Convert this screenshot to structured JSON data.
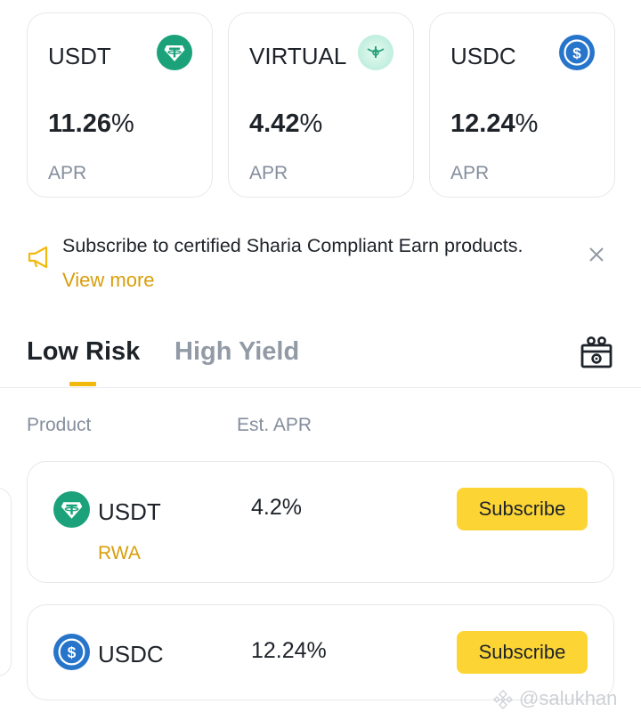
{
  "apr_cards": [
    {
      "symbol": "USDT",
      "apr": "11.26",
      "pct": "%",
      "apr_label": "APR",
      "icon": "tether-icon",
      "color": "#1ba27a"
    },
    {
      "symbol": "VIRTUAL",
      "apr": "4.42",
      "pct": "%",
      "apr_label": "APR",
      "icon": "virtual-icon",
      "color": "#bff0e0"
    },
    {
      "symbol": "USDC",
      "apr": "12.24",
      "pct": "%",
      "apr_label": "APR",
      "icon": "usdc-icon",
      "color": "#2775ca"
    }
  ],
  "banner": {
    "message": "Subscribe to certified Sharia Compliant Earn products.",
    "link": "View more",
    "icon": "megaphone-icon"
  },
  "tabs": [
    {
      "label": "Low Risk",
      "active": true
    },
    {
      "label": "High Yield",
      "active": false
    }
  ],
  "columns": {
    "product": "Product",
    "apr": "Est. APR"
  },
  "products": [
    {
      "name": "USDT",
      "tag": "RWA",
      "apr": "4.2%",
      "action": "Subscribe",
      "icon": "tether-icon"
    },
    {
      "name": "USDC",
      "tag": "",
      "apr": "12.24%",
      "action": "Subscribe",
      "icon": "usdc-icon"
    }
  ],
  "watermark": "@salukhan",
  "colors": {
    "accent_yellow": "#fcd535",
    "link_gold": "#d89e0b",
    "text_primary": "#1e2329",
    "text_secondary": "#848e9c"
  }
}
